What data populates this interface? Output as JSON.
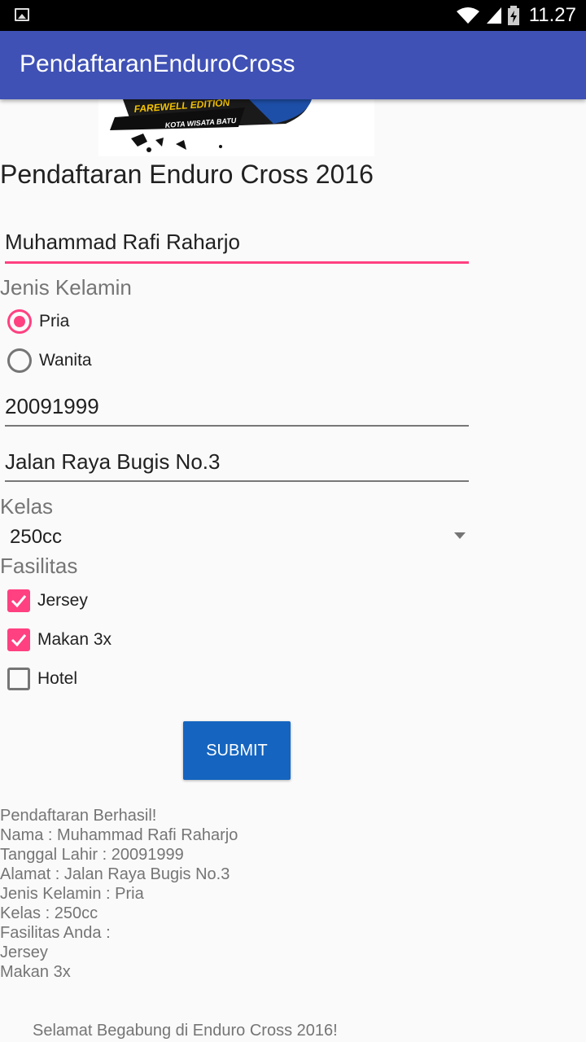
{
  "status_bar": {
    "time": "11.27",
    "icons": [
      "image-icon",
      "wifi-icon",
      "signal-icon",
      "battery-charging-icon"
    ]
  },
  "app_bar": {
    "title": "PendaftaranEnduroCross"
  },
  "banner": {
    "line1": "FAREWELL EDITION",
    "line2": "KOTA WISATA BATU"
  },
  "form": {
    "title": "Pendaftaran Enduro Cross 2016",
    "name_value": "Muhammad Rafi Raharjo",
    "gender_label": "Jenis Kelamin",
    "gender_options": [
      {
        "label": "Pria",
        "checked": true
      },
      {
        "label": "Wanita",
        "checked": false
      }
    ],
    "birth_value": "20091999",
    "address_value": "Jalan Raya Bugis No.3",
    "class_label": "Kelas",
    "class_value": "250cc",
    "facility_label": "Fasilitas",
    "facilities": [
      {
        "label": "Jersey",
        "checked": true
      },
      {
        "label": "Makan 3x",
        "checked": true
      },
      {
        "label": "Hotel",
        "checked": false
      }
    ],
    "submit_label": "SUBMIT"
  },
  "result": {
    "lines": [
      "Pendaftaran Berhasil!",
      "Nama : Muhammad Rafi Raharjo",
      "Tanggal Lahir : 20091999",
      "Alamat : Jalan Raya Bugis No.3",
      "Jenis Kelamin : Pria",
      "Kelas : 250cc",
      "Fasilitas Anda :",
      "Jersey",
      "Makan 3x"
    ],
    "welcome": "Selamat Begabung di Enduro Cross 2016!"
  },
  "colors": {
    "primary": "#3f51b5",
    "accent": "#ff4081",
    "button": "#1565c0"
  }
}
